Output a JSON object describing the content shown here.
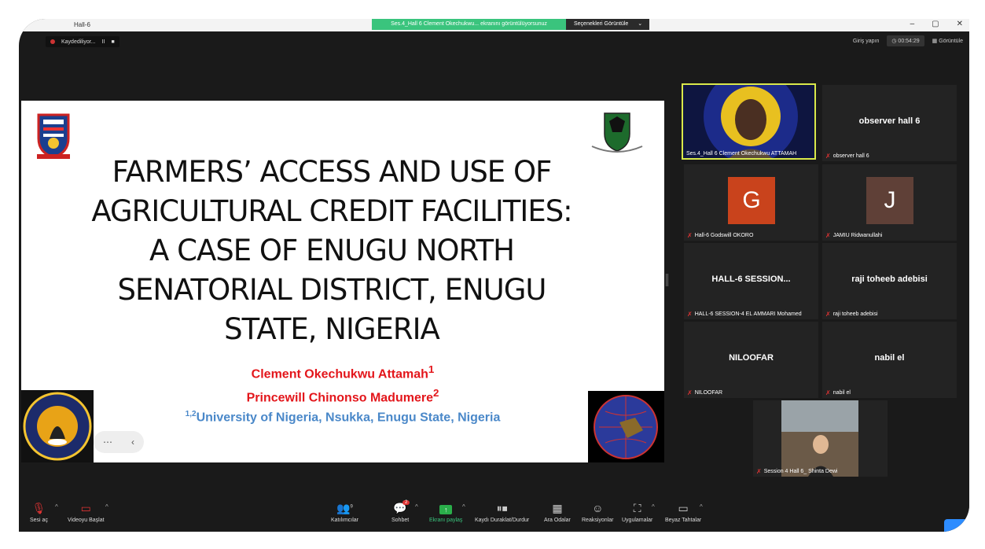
{
  "window": {
    "title": "Hall-6",
    "share_banner": "Ses.4_Hall 6 Clement Okechukwu... ekranını görüntülüyorsunuz",
    "share_options": "Seçenekleri Görüntüle",
    "minimize": "–",
    "maximize": "▢",
    "close": "✕"
  },
  "top": {
    "recording": "Kaydediliyor...",
    "pause": "II",
    "stop": "■",
    "login": "Giriş yapın",
    "timer": "00:54:29",
    "view": "Görüntüle"
  },
  "slide": {
    "title_lines": [
      "FARMERS’ ACCESS AND USE OF",
      "AGRICULTURAL CREDIT FACILITIES:",
      "A CASE OF ENUGU NORTH",
      "SENATORIAL DISTRICT, ENUGU",
      "STATE, NIGERIA"
    ],
    "author1": "Clement Okechukwu Attamah",
    "author1_sup": "1",
    "author2": "Princewill Chinonso Madumere",
    "author2_sup": "2",
    "univ_sup": "1,2",
    "univ": "University of Nigeria, Nsukka, Enugu State, Nigeria"
  },
  "participants": [
    {
      "center": "",
      "label": "Ses.4_Hall 6 Clement Okechukwu ATTAMAH",
      "muted": false
    },
    {
      "center": "observer hall 6",
      "label": "observer hall 6",
      "muted": true
    },
    {
      "avatar": "G",
      "avatar_color": "#c9431c",
      "label": "Hall-6 Godswill OKORO",
      "muted": true
    },
    {
      "avatar": "J",
      "avatar_color": "#5f4037",
      "label": "JAMIU Ridwanullahi",
      "muted": true
    },
    {
      "center": "HALL-6  SESSION...",
      "label": "HALL-6 SESSION-4 EL AMMARI Mohamed",
      "muted": true
    },
    {
      "center": "raji toheeb adebisi",
      "label": "raji toheeb adebisi",
      "muted": true
    },
    {
      "center": "NILOOFAR",
      "label": "NILOOFAR",
      "muted": true
    },
    {
      "center": "nabil el",
      "label": "nabil el",
      "muted": true
    },
    {
      "center": "",
      "label": "Session 4 Hall 6_ Shinta Dewi",
      "muted": true
    }
  ],
  "toolbar": {
    "mute": "Sesi aç",
    "video": "Videoyu Başlat",
    "participants": "Katılımcılar",
    "participants_count": "9",
    "chat": "Sohbet",
    "chat_badge": "2",
    "share": "Ekranı paylaş",
    "record": "Kaydı Duraklat/Durdur",
    "breakout": "Ara Odalar",
    "reactions": "Reaksiyonlar",
    "apps": "Uygulamalar",
    "whiteboard": "Beyaz Tahtalar"
  },
  "colors": {
    "accent_green": "#3ac47d",
    "active_border": "#d9e84a",
    "author_red": "#e3161b",
    "univ_blue": "#4a88c9"
  }
}
